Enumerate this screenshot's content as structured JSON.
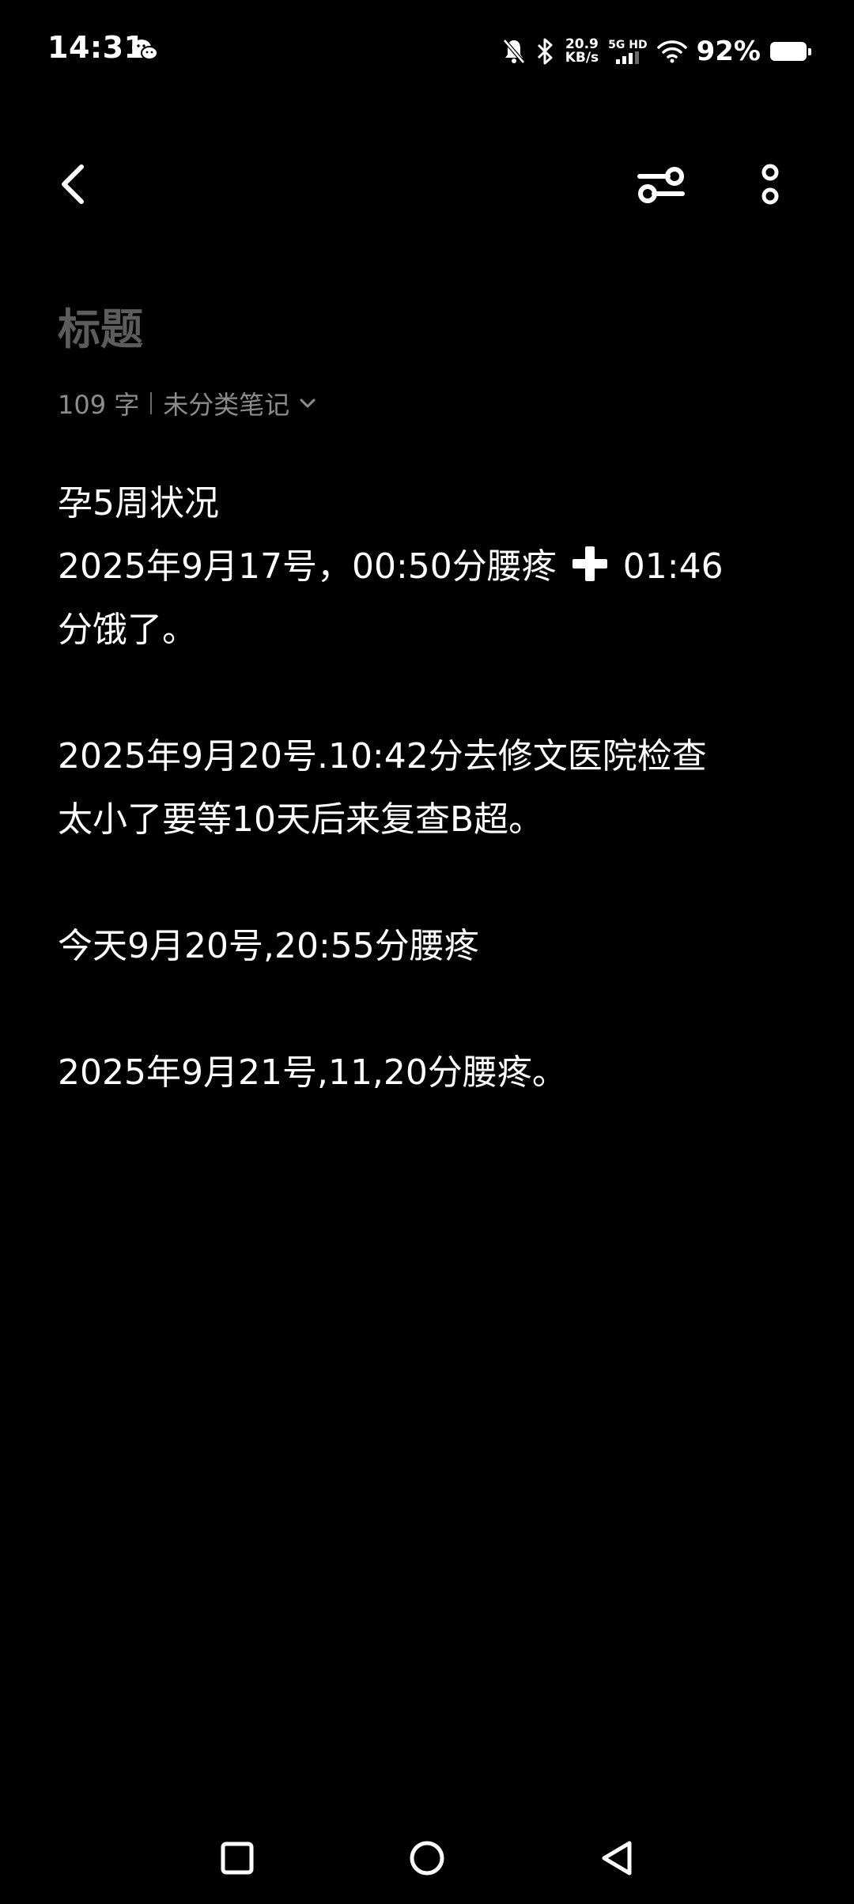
{
  "status_bar": {
    "time": "14:31",
    "net_speed_value": "20.9",
    "net_speed_unit": "KB/s",
    "net_type_top": "5G HD",
    "battery_percent": "92%",
    "icons": [
      "wechat-icon",
      "mute-bell-icon",
      "bluetooth-icon",
      "signal-icon",
      "wifi-icon",
      "battery-icon"
    ]
  },
  "toolbar": {
    "back_icon": "chevron-left-icon",
    "filter_icon": "filter-settings-icon",
    "more_icon": "more-vertical-icon"
  },
  "note": {
    "title_placeholder": "标题",
    "char_count": "109 字",
    "category": "未分类笔记",
    "lines": {
      "l1": "孕5周状况",
      "l2a": "2025年9月17号，00:50分腰疼",
      "l2b": "01:46",
      "l3": "分饿了。",
      "l4": "2025年9月20号.10:42分去修文医院检查",
      "l5": "太小了要等10天后来复查B超。",
      "l6": "今天9月20号,20:55分腰疼",
      "l7": "2025年9月21号,11,20分腰疼。"
    }
  },
  "nav_bar": {
    "icons": [
      "recent-apps-icon",
      "home-icon",
      "back-triangle-icon"
    ]
  },
  "colors": {
    "background": "#000000",
    "text": "#ffffff",
    "title_placeholder": "#5c5c5c",
    "meta": "#8c8c8c"
  }
}
